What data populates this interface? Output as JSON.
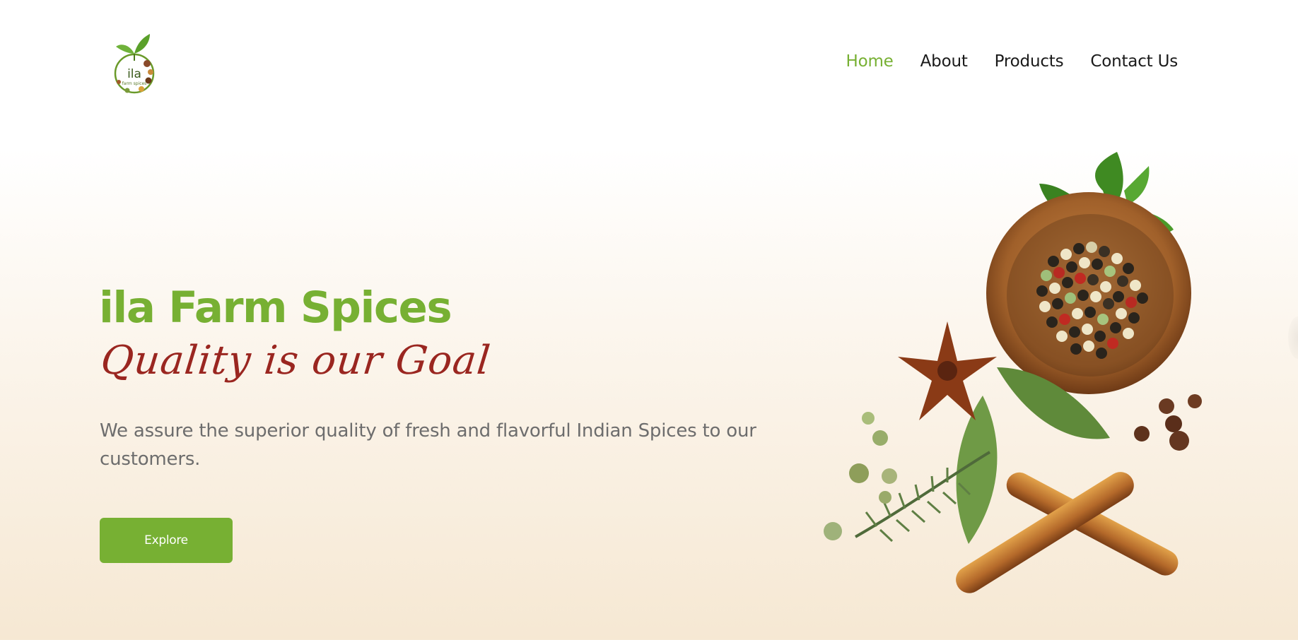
{
  "brand": {
    "logo_text": "ila",
    "logo_subtext": "farm spices"
  },
  "nav": {
    "items": [
      {
        "label": "Home",
        "active": true
      },
      {
        "label": "About",
        "active": false
      },
      {
        "label": "Products",
        "active": false
      },
      {
        "label": "Contact Us",
        "active": false
      }
    ]
  },
  "hero": {
    "title": "ila Farm Spices",
    "tagline": "Quality is our Goal",
    "description": "We assure the superior quality of fresh and flavorful Indian Spices to our customers.",
    "cta_label": "Explore"
  },
  "theme": {
    "brand_green": "#77b033",
    "tagline_red": "#9a2620",
    "text_gray": "#6d6d6d",
    "background_cream": "#f6e8d3"
  },
  "image": {
    "subject": "spices-arrangement"
  }
}
